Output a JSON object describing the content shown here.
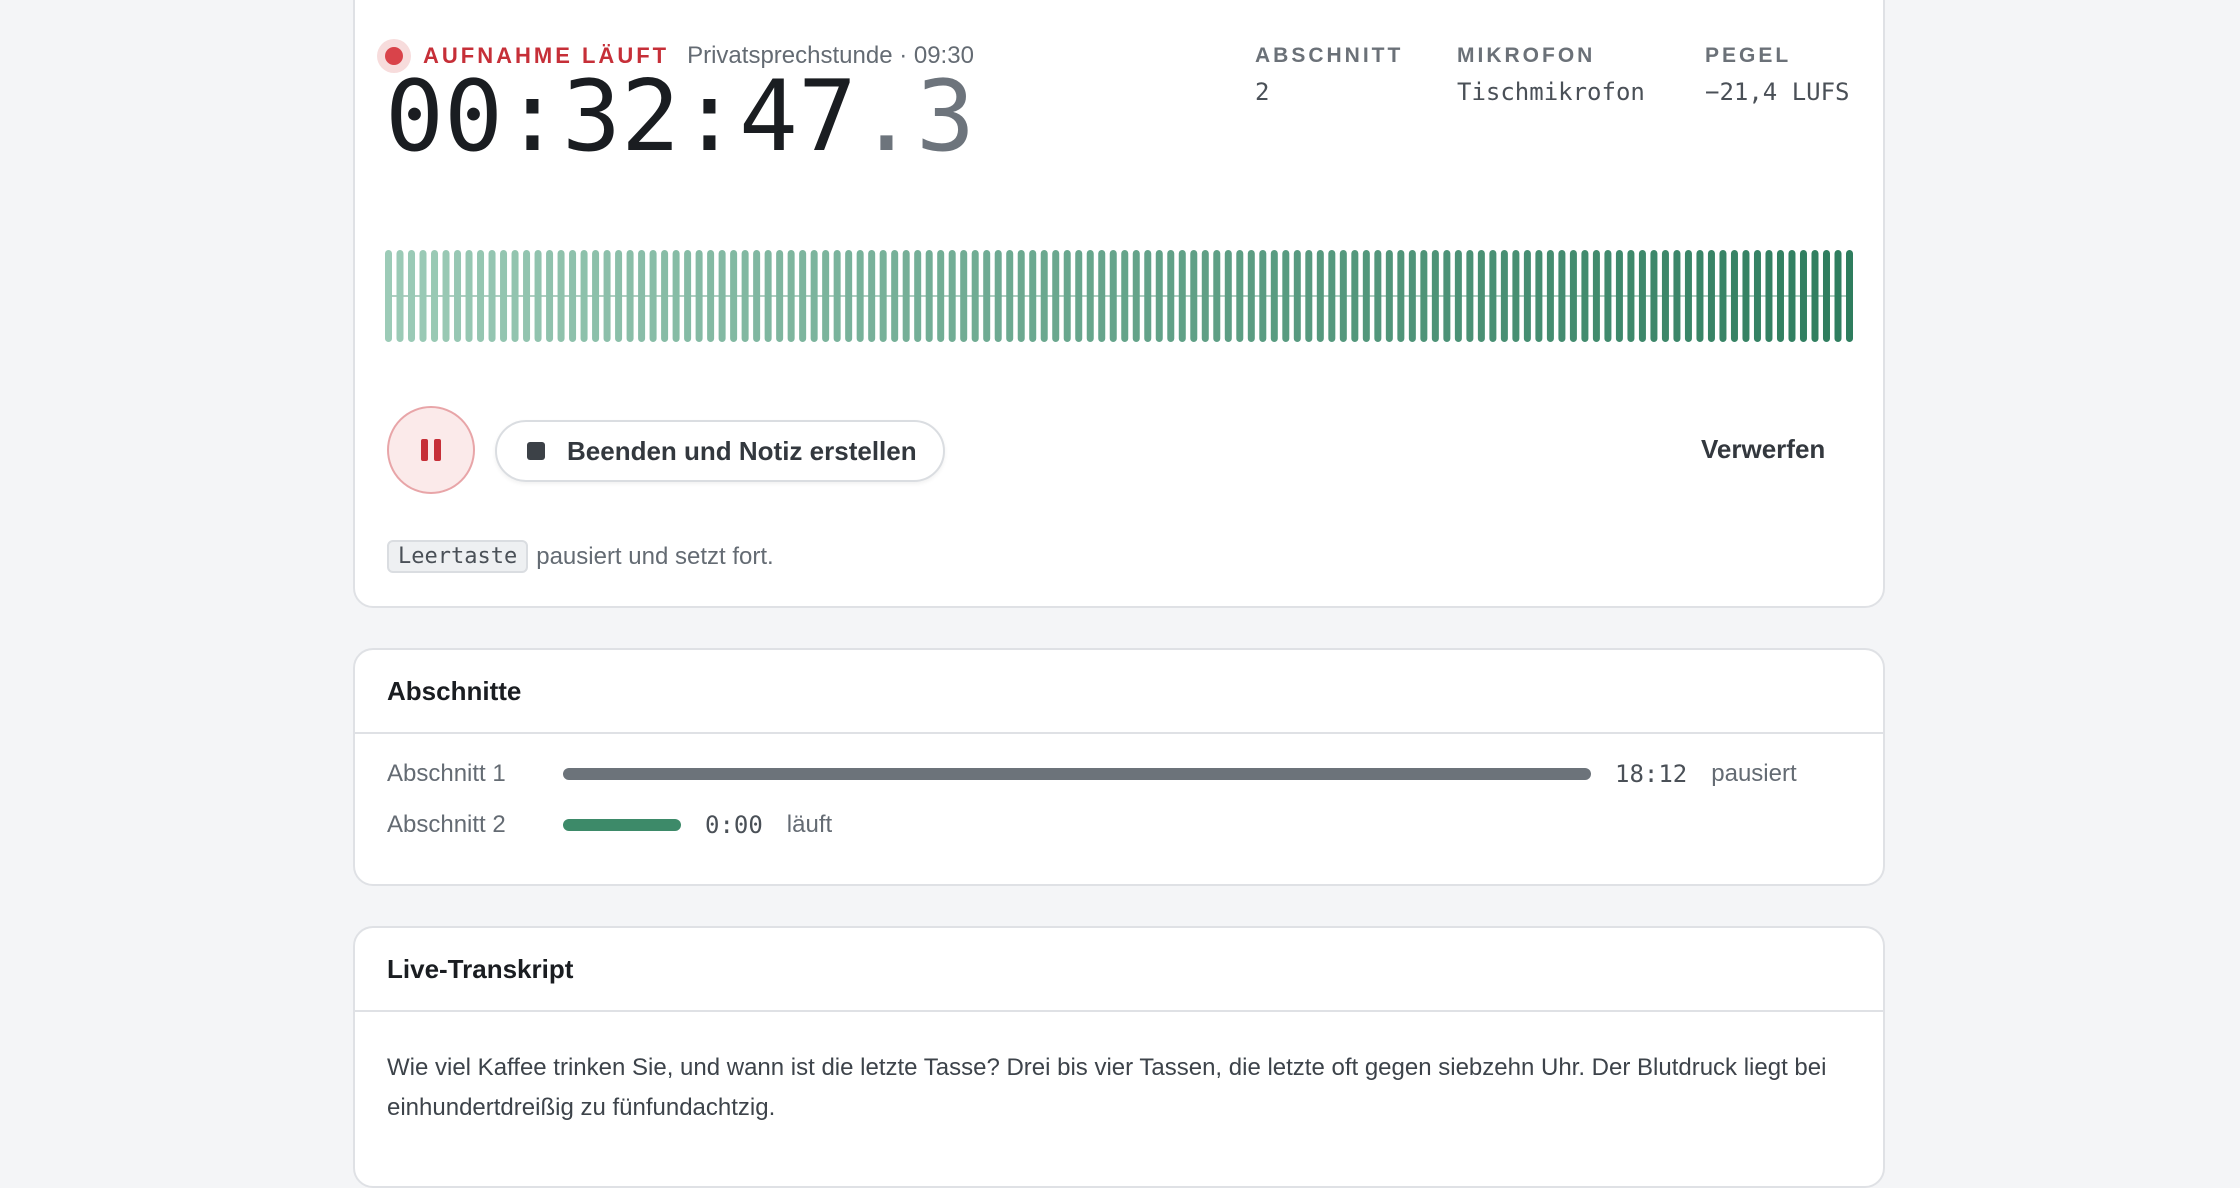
{
  "recording": {
    "status_label": "AUFNAHME LÄUFT",
    "session": "Privatsprechstunde · 09:30",
    "timer_main": "00:32:47",
    "timer_fraction": ".3",
    "meta": [
      {
        "label": "ABSCHNITT",
        "value": "2"
      },
      {
        "label": "MIKROFON",
        "value": "Tischmikrofon"
      },
      {
        "label": "PEGEL",
        "value": "−21,4 LUFS"
      }
    ],
    "waveform": {
      "bar_count": 128,
      "color_start": "#9ccbb7",
      "color_end": "#2e7d5e"
    },
    "controls": {
      "pause_label": "Pause",
      "stop_label": "Beenden und Notiz erstellen",
      "discard_label": "Verwerfen"
    },
    "hint": {
      "key": "Leertaste",
      "text": "pausiert und setzt fort."
    }
  },
  "sections": {
    "title": "Abschnitte",
    "items": [
      {
        "name": "Abschnitt 1",
        "time": "18:12",
        "status": "pausiert",
        "color": "#6c737a"
      },
      {
        "name": "Abschnitt 2",
        "time": "0:00",
        "status": "läuft",
        "color": "#3d8a69"
      }
    ]
  },
  "transcript": {
    "title": "Live-Transkript",
    "text": "Wie viel Kaffee trinken Sie, und wann ist die letzte Tasse? Drei bis vier Tassen, die letzte oft gegen siebzehn Uhr. Der Blutdruck liegt bei einhundertdreißig zu fünfundachtzig."
  },
  "colors": {
    "accent_red": "#c62f38",
    "accent_green": "#2e7d5e",
    "background": "#f4f5f7"
  }
}
